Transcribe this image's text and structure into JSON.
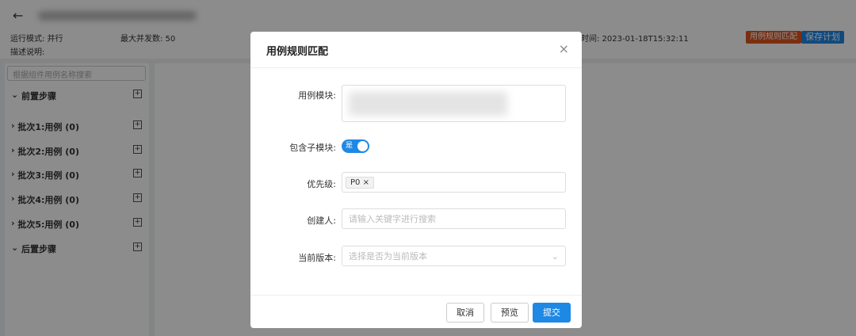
{
  "header": {
    "back": "←",
    "run_mode": "运行模式: 并行",
    "max_concurrency": "最大并发数: 50",
    "description": "描述说明:",
    "time": "时间: 2023-01-18T15:32:11",
    "rule_match_button": "用例规则匹配",
    "save_plan_button": "保存计划"
  },
  "colors": {
    "rule_match": "#e0541e",
    "save": "#1e88e5",
    "primary": "#1e88e5"
  },
  "sidebar": {
    "search_placeholder": "根据组件用例名称搜索",
    "items": [
      {
        "label": "前置步骤",
        "expanded": true
      },
      {
        "label": "批次1:用例 (0)"
      },
      {
        "label": "批次2:用例 (0)"
      },
      {
        "label": "批次3:用例 (0)"
      },
      {
        "label": "批次4:用例 (0)"
      },
      {
        "label": "批次5:用例 (0)"
      },
      {
        "label": "后置步骤",
        "expanded": true
      }
    ]
  },
  "modal": {
    "title": "用例规则匹配",
    "close": "×",
    "module_label": "用例模块:",
    "include_sub_label": "包含子模块:",
    "include_sub_value": "是",
    "priority_label": "优先级:",
    "priority_tag": "P0",
    "creator_label": "创建人:",
    "creator_placeholder": "请输入关键字进行搜索",
    "version_label": "当前版本:",
    "version_placeholder": "选择是否为当前版本",
    "cancel": "取消",
    "preview": "预览",
    "submit": "提交"
  }
}
